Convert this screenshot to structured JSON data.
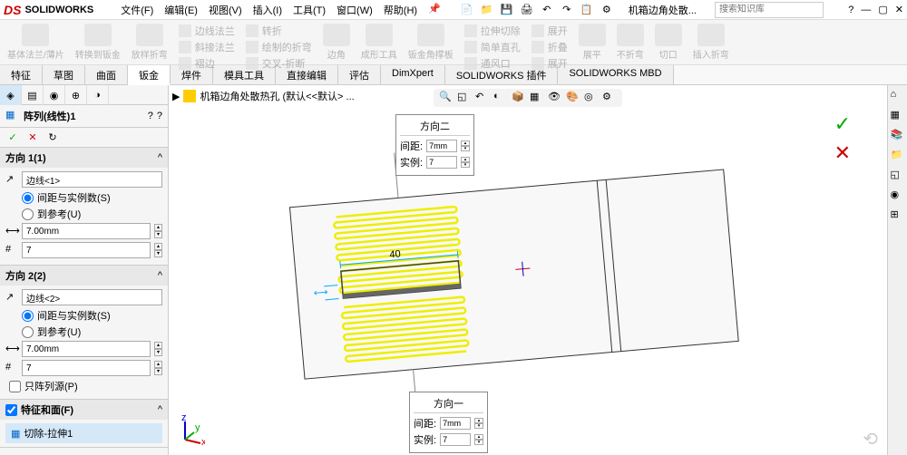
{
  "brand": {
    "logo": "DS",
    "name": "SOLIDWORKS"
  },
  "menu": [
    "文件(F)",
    "编辑(E)",
    "视图(V)",
    "插入(I)",
    "工具(T)",
    "窗口(W)",
    "帮助(H)"
  ],
  "doc_title": "机箱边角处散...",
  "search_placeholder": "搜索知识库",
  "ribbon": {
    "groups": [
      "基体法兰/薄片",
      "转换到钣金",
      "放样折弯"
    ],
    "sub": [
      "边线法兰",
      "斜接法兰",
      "褶边",
      "转折",
      "绘制的折弯",
      "交叉-折断",
      "边角",
      "成形工具",
      "钣金角撑板",
      "拉伸切除",
      "简单直孔",
      "通风口",
      "展开",
      "折叠",
      "展开",
      "展平",
      "不折弯",
      "切口",
      "插入折弯"
    ]
  },
  "tabs": [
    "特征",
    "草图",
    "曲面",
    "钣金",
    "焊件",
    "模具工具",
    "直接编辑",
    "评估",
    "DimXpert",
    "SOLIDWORKS 插件",
    "SOLIDWORKS MBD"
  ],
  "active_tab": "钣金",
  "feature": {
    "name": "阵列(线性)1",
    "dir1": {
      "title": "方向 1(1)",
      "edge": "边线<1>",
      "opt1": "间距与实例数(S)",
      "opt2": "到参考(U)",
      "spacing": "7.00mm",
      "count": "7"
    },
    "dir2": {
      "title": "方向 2(2)",
      "edge": "边线<2>",
      "opt1": "间距与实例数(S)",
      "opt2": "到参考(U)",
      "spacing": "7.00mm",
      "count": "7"
    },
    "only_seed": "只阵列源(P)",
    "feat_face": "特征和面(F)",
    "item": "切除-拉伸1"
  },
  "breadcrumb": "机箱边角处散热孔 (默认<<默认> ...",
  "popup1": {
    "title": "方向二",
    "l1": "间距:",
    "v1": "7mm",
    "l2": "实例:",
    "v2": "7"
  },
  "popup2": {
    "title": "方向一",
    "l1": "间距:",
    "v1": "7mm",
    "l2": "实例:",
    "v2": "7"
  },
  "dim40": "40"
}
